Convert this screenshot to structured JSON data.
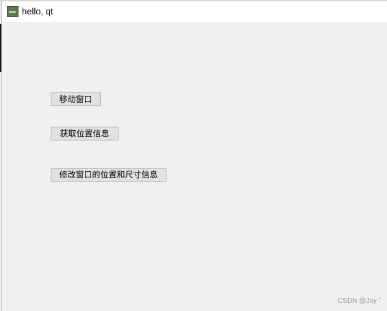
{
  "window": {
    "title": "hello, qt",
    "icon": "qt-app-icon"
  },
  "buttons": {
    "move_window": "移动窗口",
    "get_position": "获取位置信息",
    "modify_position_size": "修改窗口的位置和尺寸信息"
  },
  "watermark": "CSDN @Joy ˆ"
}
